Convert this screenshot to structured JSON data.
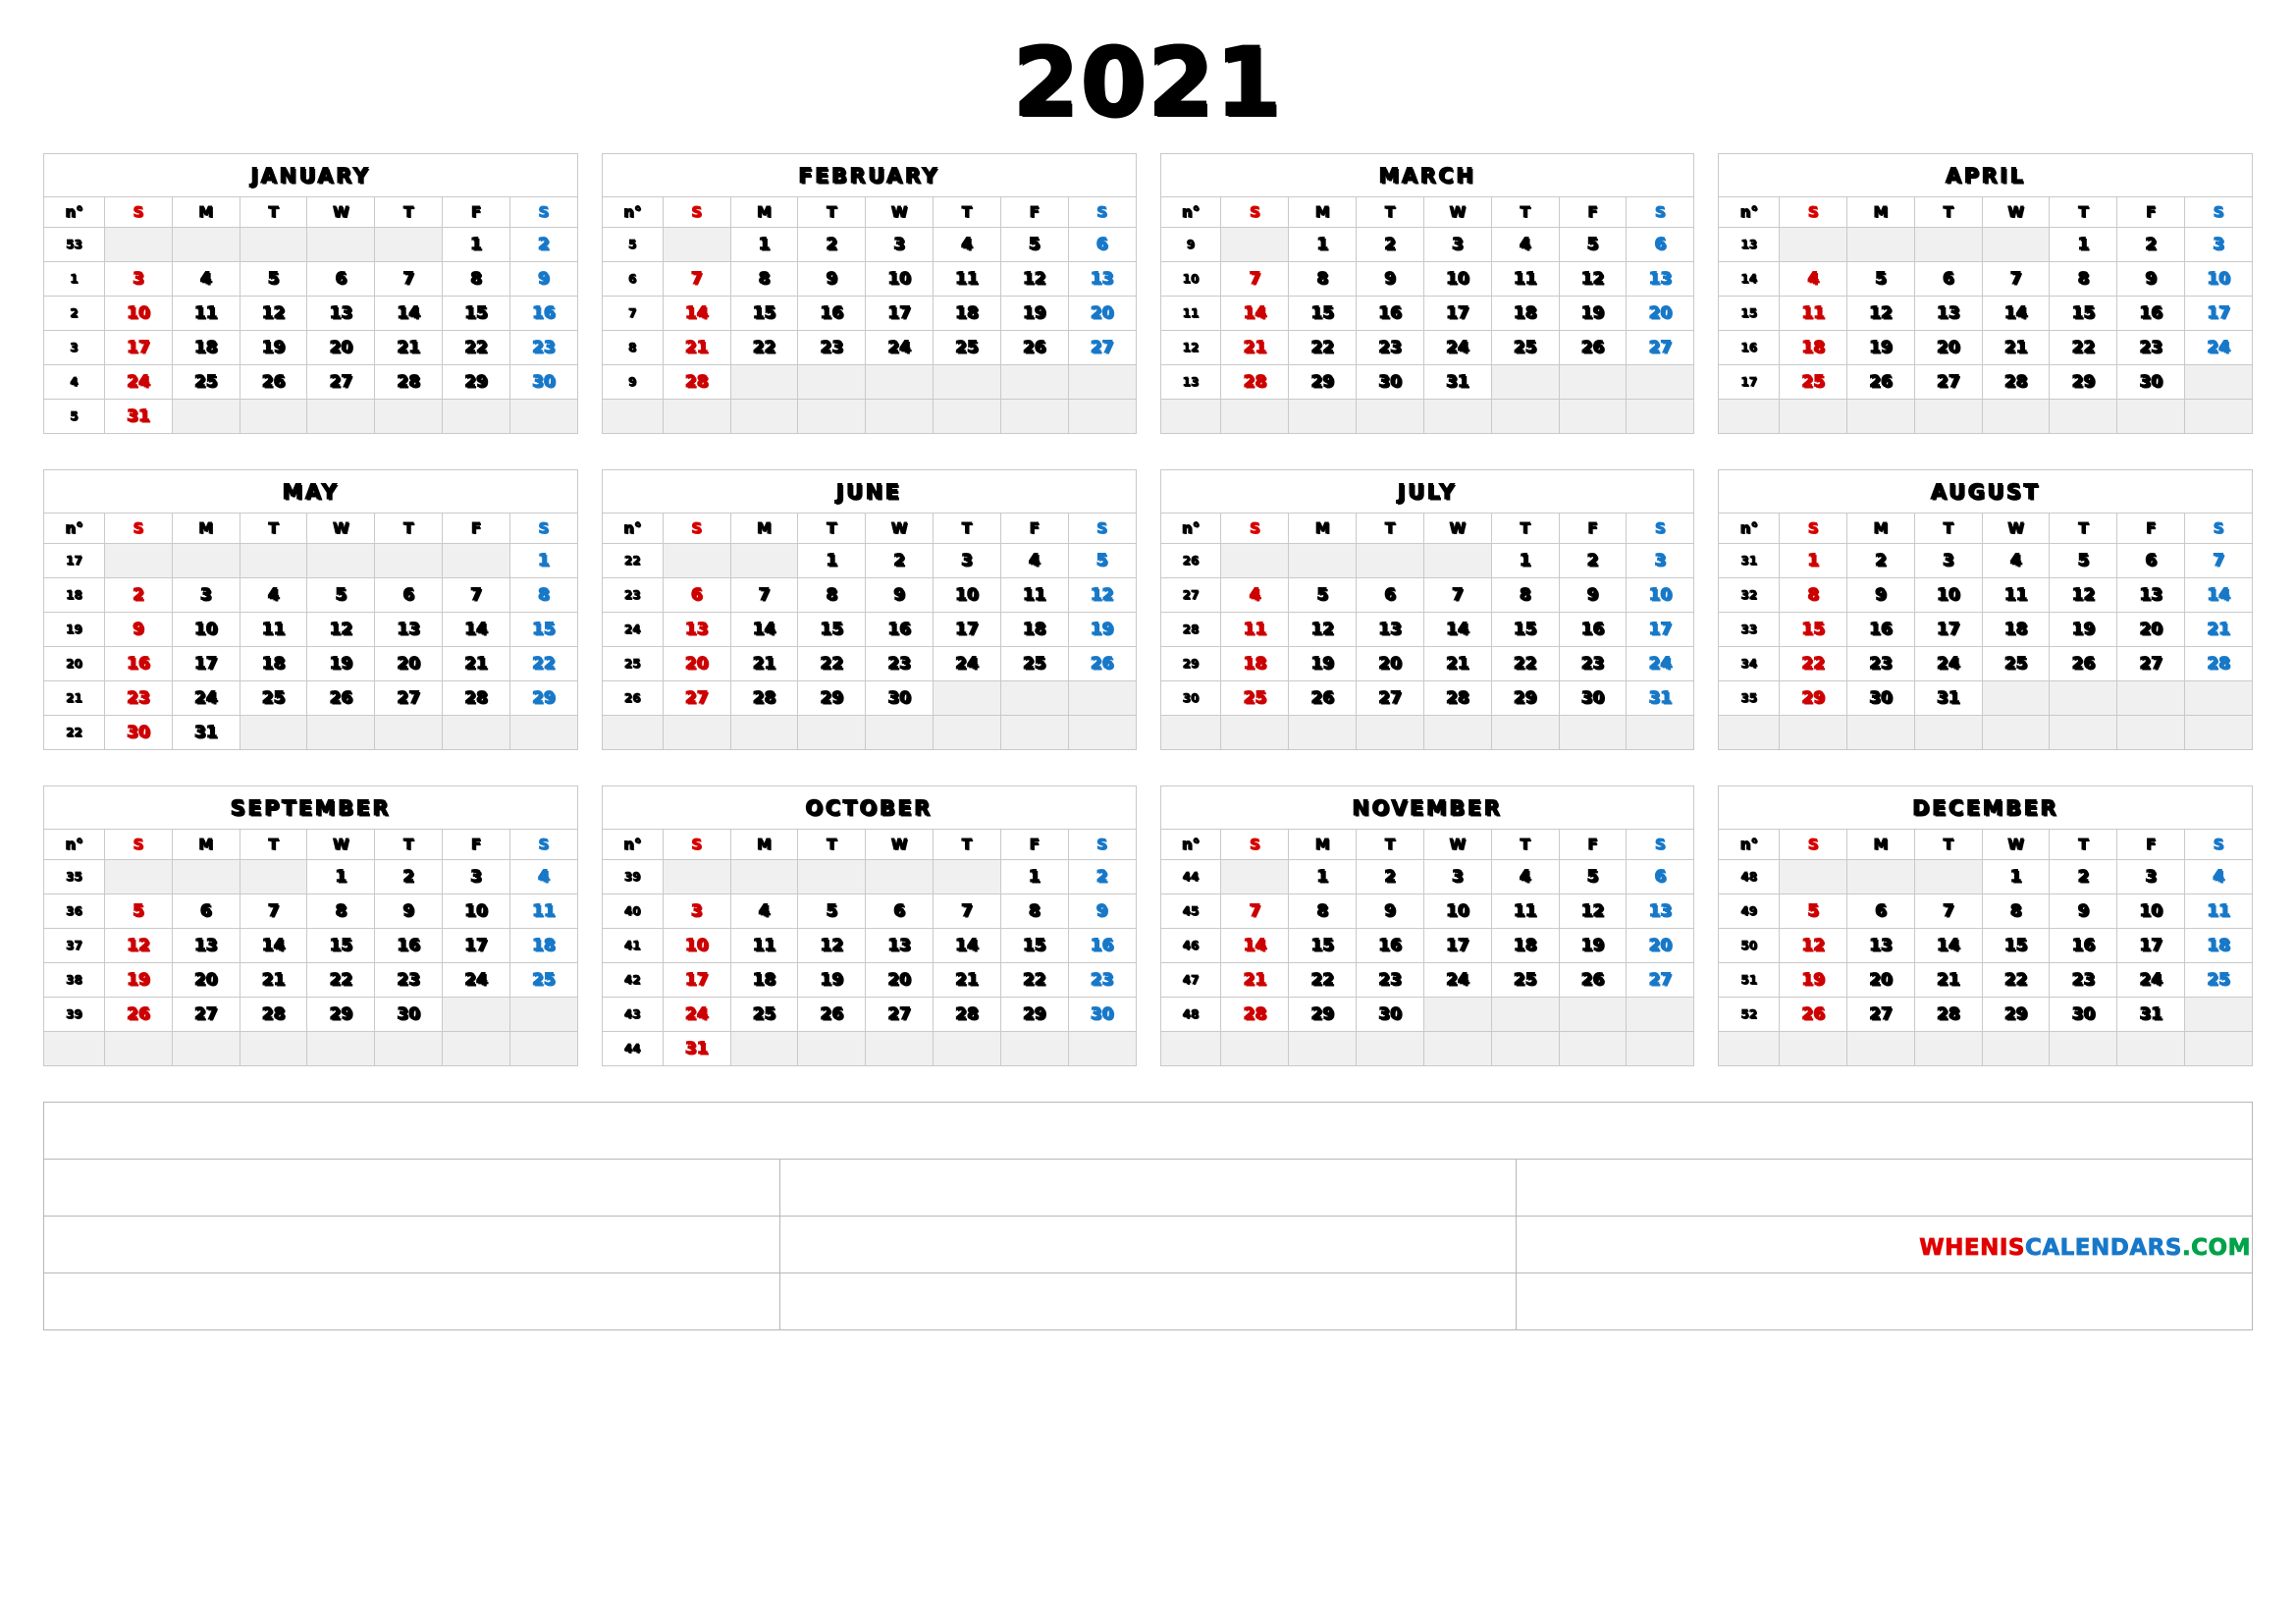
{
  "title": "2021",
  "watermark": {
    "part1": "WHENIS",
    "part2": "CALENDARS",
    "part3": ".COM"
  },
  "colors": {
    "sunday": "#cc0000",
    "saturday": "#1878c8",
    "weekday": "#000000",
    "grid_line": "#c9c9c9",
    "empty_cell": "#f0f0f0",
    "watermark_red": "#e00000",
    "watermark_blue": "#1878c8",
    "watermark_green": "#00a24a"
  },
  "weekday_headers": [
    "n°",
    "S",
    "M",
    "T",
    "W",
    "T",
    "F",
    "S"
  ],
  "notes": {
    "rows": 4,
    "first_row_full_width": true,
    "cells": [
      [
        ""
      ],
      [
        "",
        "",
        ""
      ],
      [
        "",
        "",
        ""
      ],
      [
        "",
        "",
        ""
      ]
    ]
  },
  "months": [
    {
      "name": "JANUARY",
      "weeks": [
        {
          "wk": "53",
          "days": [
            "",
            "",
            "",
            "",
            "",
            "1",
            "2"
          ]
        },
        {
          "wk": "1",
          "days": [
            "3",
            "4",
            "5",
            "6",
            "7",
            "8",
            "9"
          ]
        },
        {
          "wk": "2",
          "days": [
            "10",
            "11",
            "12",
            "13",
            "14",
            "15",
            "16"
          ]
        },
        {
          "wk": "3",
          "days": [
            "17",
            "18",
            "19",
            "20",
            "21",
            "22",
            "23"
          ]
        },
        {
          "wk": "4",
          "days": [
            "24",
            "25",
            "26",
            "27",
            "28",
            "29",
            "30"
          ]
        },
        {
          "wk": "5",
          "days": [
            "31",
            "",
            "",
            "",
            "",
            "",
            ""
          ]
        }
      ]
    },
    {
      "name": "FEBRUARY",
      "weeks": [
        {
          "wk": "5",
          "days": [
            "",
            "1",
            "2",
            "3",
            "4",
            "5",
            "6"
          ]
        },
        {
          "wk": "6",
          "days": [
            "7",
            "8",
            "9",
            "10",
            "11",
            "12",
            "13"
          ]
        },
        {
          "wk": "7",
          "days": [
            "14",
            "15",
            "16",
            "17",
            "18",
            "19",
            "20"
          ]
        },
        {
          "wk": "8",
          "days": [
            "21",
            "22",
            "23",
            "24",
            "25",
            "26",
            "27"
          ]
        },
        {
          "wk": "9",
          "days": [
            "28",
            "",
            "",
            "",
            "",
            "",
            ""
          ]
        },
        {
          "wk": "",
          "days": [
            "",
            "",
            "",
            "",
            "",
            "",
            ""
          ]
        }
      ]
    },
    {
      "name": "MARCH",
      "weeks": [
        {
          "wk": "9",
          "days": [
            "",
            "1",
            "2",
            "3",
            "4",
            "5",
            "6"
          ]
        },
        {
          "wk": "10",
          "days": [
            "7",
            "8",
            "9",
            "10",
            "11",
            "12",
            "13"
          ]
        },
        {
          "wk": "11",
          "days": [
            "14",
            "15",
            "16",
            "17",
            "18",
            "19",
            "20"
          ]
        },
        {
          "wk": "12",
          "days": [
            "21",
            "22",
            "23",
            "24",
            "25",
            "26",
            "27"
          ]
        },
        {
          "wk": "13",
          "days": [
            "28",
            "29",
            "30",
            "31",
            "",
            "",
            ""
          ]
        },
        {
          "wk": "",
          "days": [
            "",
            "",
            "",
            "",
            "",
            "",
            ""
          ]
        }
      ]
    },
    {
      "name": "APRIL",
      "weeks": [
        {
          "wk": "13",
          "days": [
            "",
            "",
            "",
            "",
            "1",
            "2",
            "3"
          ]
        },
        {
          "wk": "14",
          "days": [
            "4",
            "5",
            "6",
            "7",
            "8",
            "9",
            "10"
          ]
        },
        {
          "wk": "15",
          "days": [
            "11",
            "12",
            "13",
            "14",
            "15",
            "16",
            "17"
          ]
        },
        {
          "wk": "16",
          "days": [
            "18",
            "19",
            "20",
            "21",
            "22",
            "23",
            "24"
          ]
        },
        {
          "wk": "17",
          "days": [
            "25",
            "26",
            "27",
            "28",
            "29",
            "30",
            ""
          ]
        },
        {
          "wk": "",
          "days": [
            "",
            "",
            "",
            "",
            "",
            "",
            ""
          ]
        }
      ]
    },
    {
      "name": "MAY",
      "weeks": [
        {
          "wk": "17",
          "days": [
            "",
            "",
            "",
            "",
            "",
            "",
            "1"
          ]
        },
        {
          "wk": "18",
          "days": [
            "2",
            "3",
            "4",
            "5",
            "6",
            "7",
            "8"
          ]
        },
        {
          "wk": "19",
          "days": [
            "9",
            "10",
            "11",
            "12",
            "13",
            "14",
            "15"
          ]
        },
        {
          "wk": "20",
          "days": [
            "16",
            "17",
            "18",
            "19",
            "20",
            "21",
            "22"
          ]
        },
        {
          "wk": "21",
          "days": [
            "23",
            "24",
            "25",
            "26",
            "27",
            "28",
            "29"
          ]
        },
        {
          "wk": "22",
          "days": [
            "30",
            "31",
            "",
            "",
            "",
            "",
            ""
          ]
        }
      ]
    },
    {
      "name": "JUNE",
      "weeks": [
        {
          "wk": "22",
          "days": [
            "",
            "",
            "1",
            "2",
            "3",
            "4",
            "5"
          ]
        },
        {
          "wk": "23",
          "days": [
            "6",
            "7",
            "8",
            "9",
            "10",
            "11",
            "12"
          ]
        },
        {
          "wk": "24",
          "days": [
            "13",
            "14",
            "15",
            "16",
            "17",
            "18",
            "19"
          ]
        },
        {
          "wk": "25",
          "days": [
            "20",
            "21",
            "22",
            "23",
            "24",
            "25",
            "26"
          ]
        },
        {
          "wk": "26",
          "days": [
            "27",
            "28",
            "29",
            "30",
            "",
            "",
            ""
          ]
        },
        {
          "wk": "",
          "days": [
            "",
            "",
            "",
            "",
            "",
            "",
            ""
          ]
        }
      ]
    },
    {
      "name": "JULY",
      "weeks": [
        {
          "wk": "26",
          "days": [
            "",
            "",
            "",
            "",
            "1",
            "2",
            "3"
          ]
        },
        {
          "wk": "27",
          "days": [
            "4",
            "5",
            "6",
            "7",
            "8",
            "9",
            "10"
          ]
        },
        {
          "wk": "28",
          "days": [
            "11",
            "12",
            "13",
            "14",
            "15",
            "16",
            "17"
          ]
        },
        {
          "wk": "29",
          "days": [
            "18",
            "19",
            "20",
            "21",
            "22",
            "23",
            "24"
          ]
        },
        {
          "wk": "30",
          "days": [
            "25",
            "26",
            "27",
            "28",
            "29",
            "30",
            "31"
          ]
        },
        {
          "wk": "",
          "days": [
            "",
            "",
            "",
            "",
            "",
            "",
            ""
          ]
        }
      ]
    },
    {
      "name": "AUGUST",
      "weeks": [
        {
          "wk": "31",
          "days": [
            "1",
            "2",
            "3",
            "4",
            "5",
            "6",
            "7"
          ]
        },
        {
          "wk": "32",
          "days": [
            "8",
            "9",
            "10",
            "11",
            "12",
            "13",
            "14"
          ]
        },
        {
          "wk": "33",
          "days": [
            "15",
            "16",
            "17",
            "18",
            "19",
            "20",
            "21"
          ]
        },
        {
          "wk": "34",
          "days": [
            "22",
            "23",
            "24",
            "25",
            "26",
            "27",
            "28"
          ]
        },
        {
          "wk": "35",
          "days": [
            "29",
            "30",
            "31",
            "",
            "",
            "",
            ""
          ]
        },
        {
          "wk": "",
          "days": [
            "",
            "",
            "",
            "",
            "",
            "",
            ""
          ]
        }
      ]
    },
    {
      "name": "SEPTEMBER",
      "weeks": [
        {
          "wk": "35",
          "days": [
            "",
            "",
            "",
            "1",
            "2",
            "3",
            "4"
          ]
        },
        {
          "wk": "36",
          "days": [
            "5",
            "6",
            "7",
            "8",
            "9",
            "10",
            "11"
          ]
        },
        {
          "wk": "37",
          "days": [
            "12",
            "13",
            "14",
            "15",
            "16",
            "17",
            "18"
          ]
        },
        {
          "wk": "38",
          "days": [
            "19",
            "20",
            "21",
            "22",
            "23",
            "24",
            "25"
          ]
        },
        {
          "wk": "39",
          "days": [
            "26",
            "27",
            "28",
            "29",
            "30",
            "",
            ""
          ]
        },
        {
          "wk": "",
          "days": [
            "",
            "",
            "",
            "",
            "",
            "",
            ""
          ]
        }
      ]
    },
    {
      "name": "OCTOBER",
      "weeks": [
        {
          "wk": "39",
          "days": [
            "",
            "",
            "",
            "",
            "",
            "1",
            "2"
          ]
        },
        {
          "wk": "40",
          "days": [
            "3",
            "4",
            "5",
            "6",
            "7",
            "8",
            "9"
          ]
        },
        {
          "wk": "41",
          "days": [
            "10",
            "11",
            "12",
            "13",
            "14",
            "15",
            "16"
          ]
        },
        {
          "wk": "42",
          "days": [
            "17",
            "18",
            "19",
            "20",
            "21",
            "22",
            "23"
          ]
        },
        {
          "wk": "43",
          "days": [
            "24",
            "25",
            "26",
            "27",
            "28",
            "29",
            "30"
          ]
        },
        {
          "wk": "44",
          "days": [
            "31",
            "",
            "",
            "",
            "",
            "",
            ""
          ]
        }
      ]
    },
    {
      "name": "NOVEMBER",
      "weeks": [
        {
          "wk": "44",
          "days": [
            "",
            "1",
            "2",
            "3",
            "4",
            "5",
            "6"
          ]
        },
        {
          "wk": "45",
          "days": [
            "7",
            "8",
            "9",
            "10",
            "11",
            "12",
            "13"
          ]
        },
        {
          "wk": "46",
          "days": [
            "14",
            "15",
            "16",
            "17",
            "18",
            "19",
            "20"
          ]
        },
        {
          "wk": "47",
          "days": [
            "21",
            "22",
            "23",
            "24",
            "25",
            "26",
            "27"
          ]
        },
        {
          "wk": "48",
          "days": [
            "28",
            "29",
            "30",
            "",
            "",
            "",
            ""
          ]
        },
        {
          "wk": "",
          "days": [
            "",
            "",
            "",
            "",
            "",
            "",
            ""
          ]
        }
      ]
    },
    {
      "name": "DECEMBER",
      "weeks": [
        {
          "wk": "48",
          "days": [
            "",
            "",
            "",
            "1",
            "2",
            "3",
            "4"
          ]
        },
        {
          "wk": "49",
          "days": [
            "5",
            "6",
            "7",
            "8",
            "9",
            "10",
            "11"
          ]
        },
        {
          "wk": "50",
          "days": [
            "12",
            "13",
            "14",
            "15",
            "16",
            "17",
            "18"
          ]
        },
        {
          "wk": "51",
          "days": [
            "19",
            "20",
            "21",
            "22",
            "23",
            "24",
            "25"
          ]
        },
        {
          "wk": "52",
          "days": [
            "26",
            "27",
            "28",
            "29",
            "30",
            "31",
            ""
          ]
        },
        {
          "wk": "",
          "days": [
            "",
            "",
            "",
            "",
            "",
            "",
            ""
          ]
        }
      ]
    }
  ]
}
